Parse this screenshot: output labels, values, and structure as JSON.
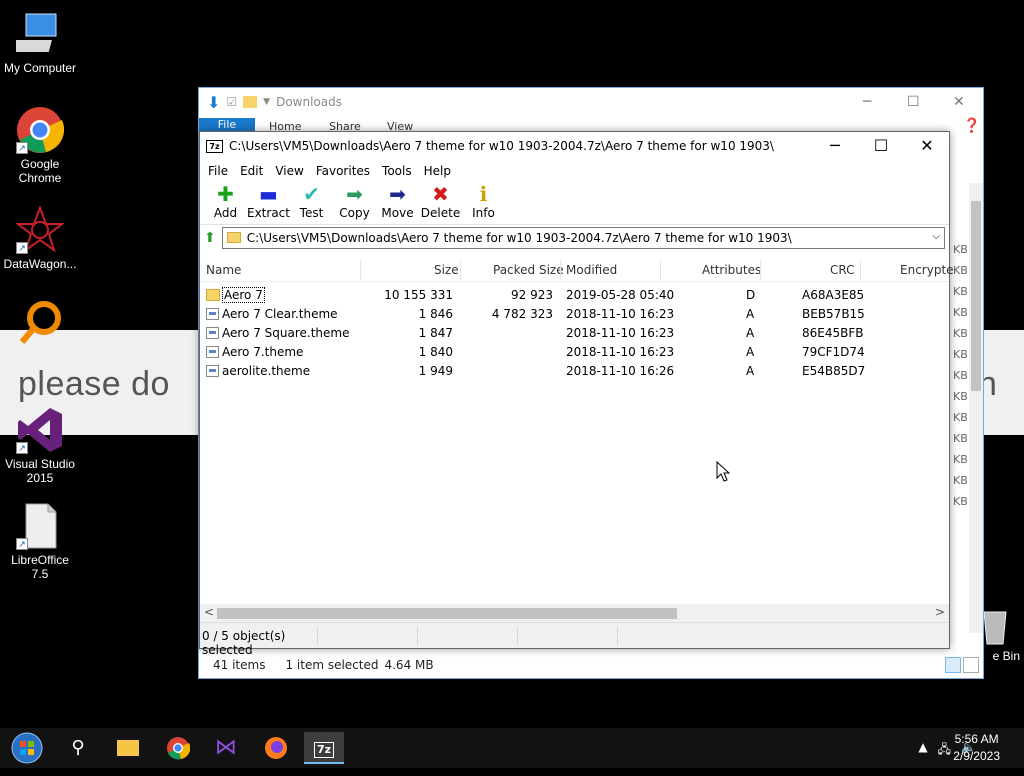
{
  "desktop": {
    "banner_text": "please do",
    "banner_end": "n",
    "icons": [
      {
        "label": "My Computer",
        "icon": "computer-icon"
      },
      {
        "label": "Google\nChrome",
        "icon": "chrome-icon"
      },
      {
        "label": "DataWagon...",
        "icon": "datawagon-icon"
      },
      {
        "label": "",
        "icon": "magnifier-app-icon"
      },
      {
        "label": "Visual Studio\n2015",
        "icon": "visual-studio-icon"
      },
      {
        "label": "LibreOffice\n7.5",
        "icon": "libreoffice-icon"
      }
    ],
    "recycle_bin_label": "e Bin"
  },
  "explorer": {
    "title": "Downloads",
    "tabs": [
      "File",
      "Home",
      "Share",
      "View"
    ],
    "status": {
      "items": "41 items",
      "selected": "1 item selected",
      "size": "4.64 MB"
    },
    "kb_column": [
      "KB",
      "KB",
      "KB",
      "KB",
      "KB",
      "KB",
      "KB",
      "KB",
      "KB",
      "KB",
      "KB",
      "KB",
      "KB"
    ]
  },
  "sevenzip": {
    "logo": "7z",
    "title": "C:\\Users\\VM5\\Downloads\\Aero 7 theme for w10 1903-2004.7z\\Aero 7 theme for w10 1903\\",
    "menu": [
      "File",
      "Edit",
      "View",
      "Favorites",
      "Tools",
      "Help"
    ],
    "toolbar": [
      {
        "label": "Add",
        "icon": "plus-icon",
        "color": "#1aa31a",
        "glyph": "✚"
      },
      {
        "label": "Extract",
        "icon": "minus-icon",
        "color": "#1c2bd6",
        "glyph": "▬"
      },
      {
        "label": "Test",
        "icon": "check-icon",
        "color": "#2fb7b0",
        "glyph": "✔"
      },
      {
        "label": "Copy",
        "icon": "copy-arrow-icon",
        "color": "#2a9a5e",
        "glyph": "➡"
      },
      {
        "label": "Move",
        "icon": "move-arrow-icon",
        "color": "#1c2b8c",
        "glyph": "➡"
      },
      {
        "label": "Delete",
        "icon": "delete-x-icon",
        "color": "#d41a1a",
        "glyph": "✖"
      },
      {
        "label": "Info",
        "icon": "info-icon",
        "color": "#c7a600",
        "glyph": "ℹ"
      }
    ],
    "address": "C:\\Users\\VM5\\Downloads\\Aero 7 theme for w10 1903-2004.7z\\Aero 7 theme for w10 1903\\",
    "columns": [
      "Name",
      "Size",
      "Packed Size",
      "Modified",
      "Attributes",
      "CRC",
      "Encrypte"
    ],
    "rows": [
      {
        "name": "Aero 7",
        "size": "10 155 331",
        "packed": "92 923",
        "modified": "2019-05-28 05:40",
        "attr": "D",
        "crc": "A68A3E85",
        "folder": true
      },
      {
        "name": "Aero 7 Clear.theme",
        "size": "1 846",
        "packed": "4 782 323",
        "modified": "2018-11-10 16:23",
        "attr": "A",
        "crc": "BEB57B15",
        "folder": false
      },
      {
        "name": "Aero 7 Square.theme",
        "size": "1 847",
        "packed": "",
        "modified": "2018-11-10 16:23",
        "attr": "A",
        "crc": "86E45BFB",
        "folder": false
      },
      {
        "name": "Aero 7.theme",
        "size": "1 840",
        "packed": "",
        "modified": "2018-11-10 16:23",
        "attr": "A",
        "crc": "79CF1D74",
        "folder": false
      },
      {
        "name": "aerolite.theme",
        "size": "1 949",
        "packed": "",
        "modified": "2018-11-10 16:26",
        "attr": "A",
        "crc": "E54B85D7",
        "folder": false
      }
    ],
    "status": "0 / 5 object(s) selected"
  },
  "taskbar": {
    "time": "5:56 AM",
    "date": "2/9/2023",
    "apps": [
      {
        "name": "file-explorer-icon",
        "glyph": "📁"
      },
      {
        "name": "chrome-icon",
        "glyph": "◉"
      },
      {
        "name": "visual-studio-icon",
        "glyph": "⋈"
      },
      {
        "name": "firefox-icon",
        "glyph": "◍"
      },
      {
        "name": "sevenzip-icon",
        "glyph": "7z"
      }
    ]
  }
}
